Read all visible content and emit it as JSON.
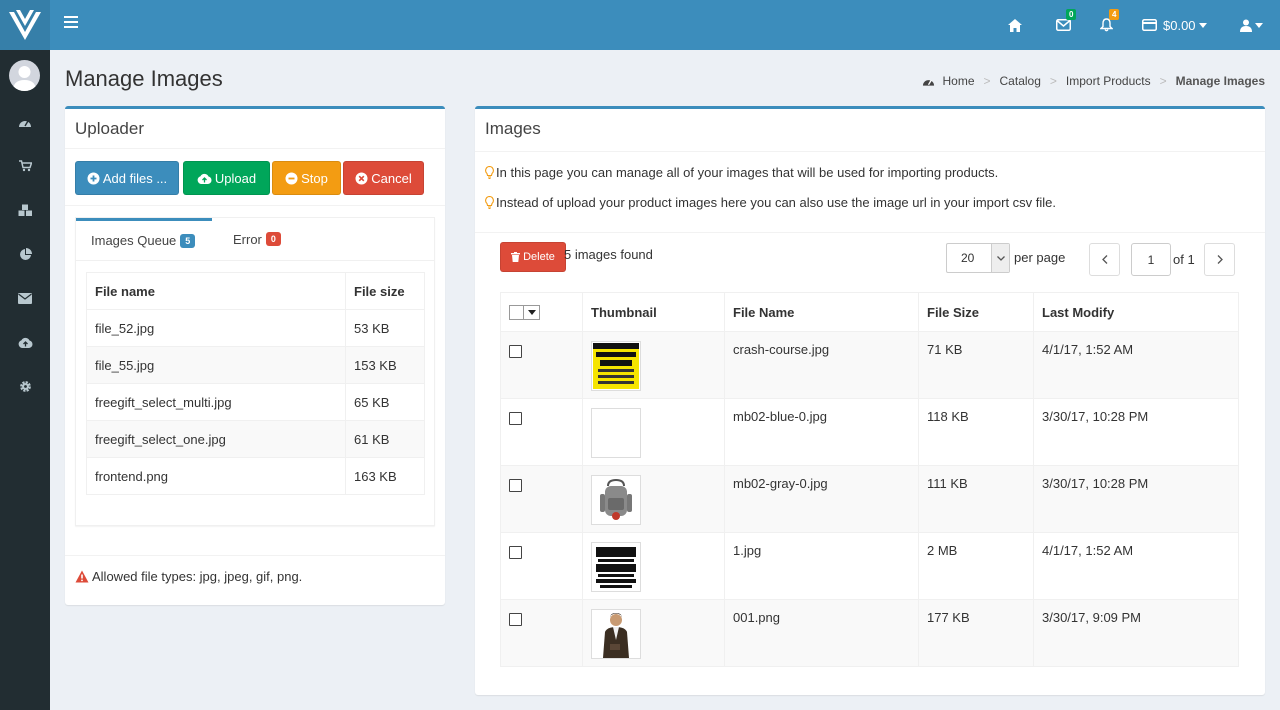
{
  "header": {
    "money": "$0.00",
    "mail_count": "0",
    "bell_count": "4",
    "colors": {
      "topbar": "#3c8dbc",
      "logo_bg": "#367fa9",
      "sidebar": "#222d32"
    }
  },
  "page": {
    "title": "Manage Images",
    "breadcrumb": [
      "Home",
      "Catalog",
      "Import Products",
      "Manage Images"
    ]
  },
  "uploader": {
    "title": "Uploader",
    "buttons": {
      "add": "Add files ...",
      "upload": "Upload",
      "stop": "Stop",
      "cancel": "Cancel"
    },
    "tabs": [
      {
        "label": "Images Queue",
        "count": "5"
      },
      {
        "label": "Error",
        "count": "0"
      }
    ],
    "columns": [
      "File name",
      "File size"
    ],
    "files": [
      {
        "name": "file_52.jpg",
        "size": "53 KB"
      },
      {
        "name": "file_55.jpg",
        "size": "153 KB"
      },
      {
        "name": "freegift_select_multi.jpg",
        "size": "65 KB"
      },
      {
        "name": "freegift_select_one.jpg",
        "size": "61 KB"
      },
      {
        "name": "frontend.png",
        "size": "163 KB"
      }
    ],
    "allowed": "Allowed file types: jpg, jpeg, gif, png."
  },
  "images": {
    "title": "Images",
    "info1": "In this page you can manage all of your images that will be used for importing products.",
    "info2": "Instead of upload your product images here you can also use the image url in your import csv file.",
    "delete_label": "Delete",
    "found": "5 images found",
    "per_page_value": "20",
    "per_page_label": "per page",
    "page_value": "1",
    "of_label": "of 1",
    "columns": [
      "Thumbnail",
      "File Name",
      "File Size",
      "Last Modify"
    ],
    "rows": [
      {
        "name": "crash-course.jpg",
        "size": "71 KB",
        "date": "4/1/17, 1:52 AM",
        "thumb": "yellow-book-icon"
      },
      {
        "name": "mb02-blue-0.jpg",
        "size": "118 KB",
        "date": "3/30/17, 10:28 PM",
        "thumb": "blank-icon"
      },
      {
        "name": "mb02-gray-0.jpg",
        "size": "111 KB",
        "date": "3/30/17, 10:28 PM",
        "thumb": "backpack-icon"
      },
      {
        "name": "1.jpg",
        "size": "2 MB",
        "date": "4/1/17, 1:52 AM",
        "thumb": "bw-book-icon"
      },
      {
        "name": "001.png",
        "size": "177 KB",
        "date": "3/30/17, 9:09 PM",
        "thumb": "person-icon"
      }
    ]
  }
}
